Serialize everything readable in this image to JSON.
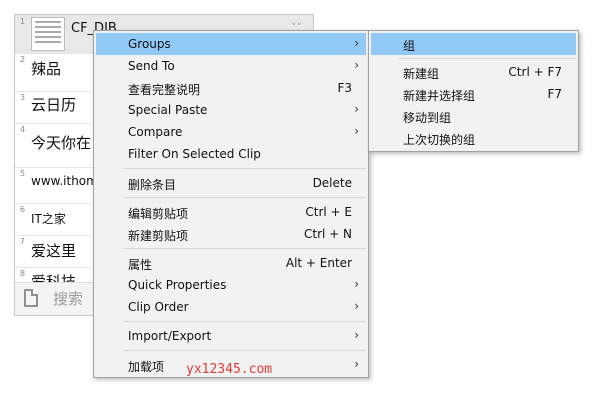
{
  "clip_list": {
    "rows": [
      {
        "num": "1",
        "text": "CF_DIB"
      },
      {
        "num": "2",
        "text": "辣品"
      },
      {
        "num": "3",
        "text": "云日历"
      },
      {
        "num": "4",
        "text": "今天你在"
      },
      {
        "num": "5",
        "text": "www.ithom"
      },
      {
        "num": "6",
        "text": "IT之家"
      },
      {
        "num": "7",
        "text": "爱这里"
      },
      {
        "num": "8",
        "text": "爱科技"
      }
    ],
    "search_placeholder": "搜索"
  },
  "context_menu": {
    "items": [
      {
        "label": "Groups",
        "shortcut": "",
        "arrow": "›"
      },
      {
        "label": "Send To",
        "shortcut": "",
        "arrow": "›"
      },
      {
        "label": "查看完整说明",
        "shortcut": "F3",
        "arrow": ""
      },
      {
        "label": "Special Paste",
        "shortcut": "",
        "arrow": "›"
      },
      {
        "label": "Compare",
        "shortcut": "",
        "arrow": "›"
      },
      {
        "label": "Filter On Selected Clip",
        "shortcut": "",
        "arrow": ""
      },
      {
        "label": "删除条目",
        "shortcut": "Delete",
        "arrow": ""
      },
      {
        "label": "编辑剪贴项",
        "shortcut": "Ctrl + E",
        "arrow": ""
      },
      {
        "label": "新建剪贴项",
        "shortcut": "Ctrl + N",
        "arrow": ""
      },
      {
        "label": "属性",
        "shortcut": "Alt + Enter",
        "arrow": ""
      },
      {
        "label": "Quick Properties",
        "shortcut": "",
        "arrow": "›"
      },
      {
        "label": "Clip Order",
        "shortcut": "",
        "arrow": "›"
      },
      {
        "label": "Import/Export",
        "shortcut": "",
        "arrow": "›"
      },
      {
        "label": "加载项",
        "shortcut": "",
        "arrow": "›"
      }
    ]
  },
  "groups_submenu": {
    "items": [
      {
        "label": "组",
        "shortcut": ""
      },
      {
        "label": "新建组",
        "shortcut": "Ctrl + F7"
      },
      {
        "label": "新建并选择组",
        "shortcut": "F7"
      },
      {
        "label": "移动到组",
        "shortcut": ""
      },
      {
        "label": "上次切换的组",
        "shortcut": ""
      }
    ]
  },
  "watermark": "yx12345.com",
  "colors": {
    "highlight": "#91c9f7",
    "menu_bg": "#f2f2f2",
    "watermark": "#e53935"
  }
}
